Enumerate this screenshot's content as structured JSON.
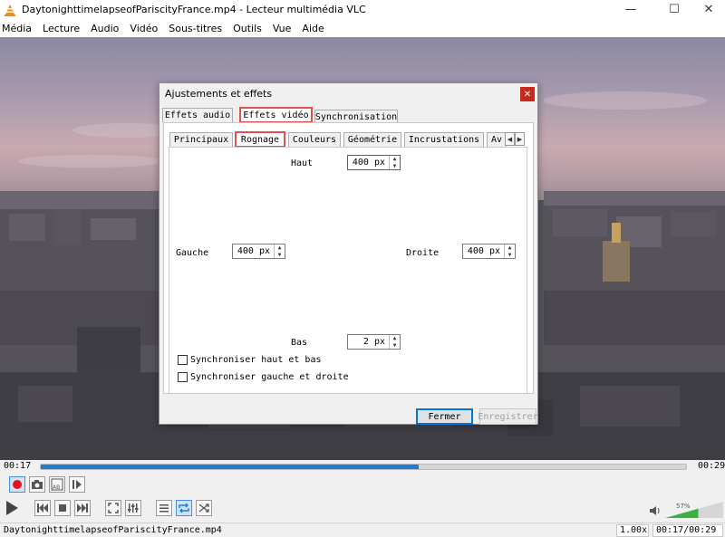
{
  "window": {
    "title": "DaytonighttimelapseofPariscityFrance.mp4 - Lecteur multimédia VLC",
    "minimize_glyph": "—",
    "maximize_glyph": "☐",
    "close_glyph": "✕"
  },
  "menu": [
    "Média",
    "Lecture",
    "Audio",
    "Vidéo",
    "Sous-titres",
    "Outils",
    "Vue",
    "Aide"
  ],
  "dialog": {
    "title": "Ajustements et effets",
    "close_glyph": "✕",
    "tabs": [
      "Effets audio",
      "Effets vidéo",
      "Synchronisation"
    ],
    "active_tab": "Effets vidéo",
    "subtabs": [
      "Principaux",
      "Rognage",
      "Couleurs",
      "Géométrie",
      "Incrustations",
      "Av"
    ],
    "active_subtab": "Rognage",
    "crop": {
      "top_label": "Haut",
      "top_value": "400 px",
      "left_label": "Gauche",
      "left_value": "400 px",
      "right_label": "Droite",
      "right_value": "400 px",
      "bottom_label": "Bas",
      "bottom_value": "2 px"
    },
    "sync_top_bottom": "Synchroniser haut et bas",
    "sync_left_right": "Synchroniser gauche et droite",
    "close_button": "Fermer",
    "save_button": "Enregistrer"
  },
  "player": {
    "elapsed": "00:17",
    "total": "00:29",
    "progress": 0.585,
    "volume_label": "57%",
    "volume": 0.57
  },
  "status": {
    "filename": "DaytonighttimelapseofPariscityFrance.mp4",
    "speed": "1.00x",
    "time": "00:17/00:29"
  },
  "colors": {
    "accent": "#1e7bd6",
    "highlight": "#e05050",
    "close_red": "#c42b1c",
    "record_red": "#e81123",
    "volume_green": "#3cb043"
  }
}
